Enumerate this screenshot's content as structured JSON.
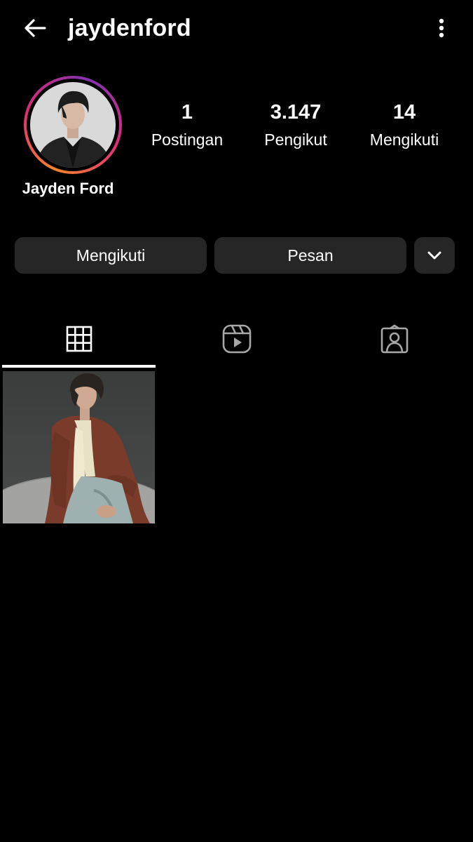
{
  "header": {
    "username": "jaydenford",
    "back_icon": "arrow-left-icon",
    "more_icon": "more-vertical-icon"
  },
  "profile": {
    "display_name": "Jayden Ford",
    "avatar": "profile-photo",
    "story_ring_colors": [
      "#f58529",
      "#dd2a7b",
      "#8134af"
    ]
  },
  "stats": [
    {
      "value": "1",
      "label": "Postingan"
    },
    {
      "value": "3.147",
      "label": "Pengikut"
    },
    {
      "value": "14",
      "label": "Mengikuti"
    }
  ],
  "actions": {
    "following_label": "Mengikuti",
    "message_label": "Pesan",
    "suggested_icon": "chevron-down-icon"
  },
  "tabs": [
    {
      "icon": "grid-icon",
      "active": true
    },
    {
      "icon": "reels-icon",
      "active": false
    },
    {
      "icon": "tagged-icon",
      "active": false
    }
  ],
  "posts": [
    {
      "image": "post-photo-brown-blazer"
    }
  ],
  "colors": {
    "background": "#000000",
    "button": "#262626",
    "text": "#ffffff",
    "inactive_icon": "#a8a8a8"
  }
}
